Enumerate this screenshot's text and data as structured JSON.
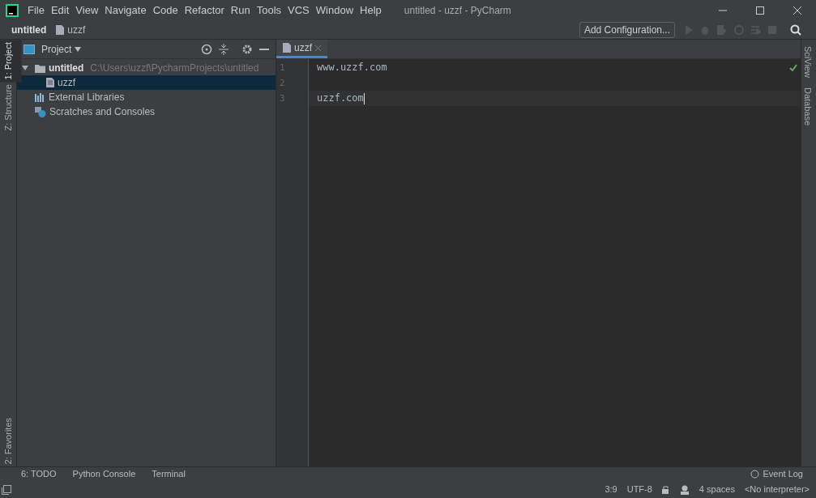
{
  "window": {
    "title": "untitled - uzzf - PyCharm"
  },
  "menu": [
    "File",
    "Edit",
    "View",
    "Navigate",
    "Code",
    "Refactor",
    "Run",
    "Tools",
    "VCS",
    "Window",
    "Help"
  ],
  "breadcrumb": [
    "untitled",
    "uzzf"
  ],
  "toolbar": {
    "config_button": "Add Configuration..."
  },
  "left_stripe": {
    "top": [
      {
        "label": "1: Project",
        "selected": true
      },
      {
        "label": "Z: Structure",
        "selected": false
      }
    ],
    "bottom": [
      {
        "label": "2: Favorites",
        "selected": false
      }
    ]
  },
  "project_panel": {
    "title": "Project",
    "tree": [
      {
        "label": "untitled",
        "kind": "folder",
        "path": "C:\\Users\\uzzf\\PycharmProjects\\untitled",
        "expanded": true,
        "selected": false,
        "children": [
          {
            "label": "uzzf",
            "kind": "file",
            "selected": true
          }
        ]
      },
      {
        "label": "External Libraries",
        "kind": "library",
        "selected": false
      },
      {
        "label": "Scratches and Consoles",
        "kind": "scratch",
        "selected": false
      }
    ]
  },
  "editor": {
    "tabs": [
      {
        "label": "uzzf",
        "selected": true
      }
    ],
    "lines": [
      {
        "number": "1",
        "text": "www.uzzf.com",
        "current": false
      },
      {
        "number": "2",
        "current": false
      },
      {
        "number": "3",
        "text": "uzzf.com",
        "current": true
      }
    ]
  },
  "right_stripe": [
    "SciView",
    "Database"
  ],
  "bottom_tabs": [
    "6: TODO",
    "Python Console",
    "Terminal"
  ],
  "event_log": "Event Log",
  "status_bar": {
    "position": "3:9",
    "encoding": "UTF-8",
    "indent": "4 spaces",
    "interpreter": "<No interpreter>"
  }
}
